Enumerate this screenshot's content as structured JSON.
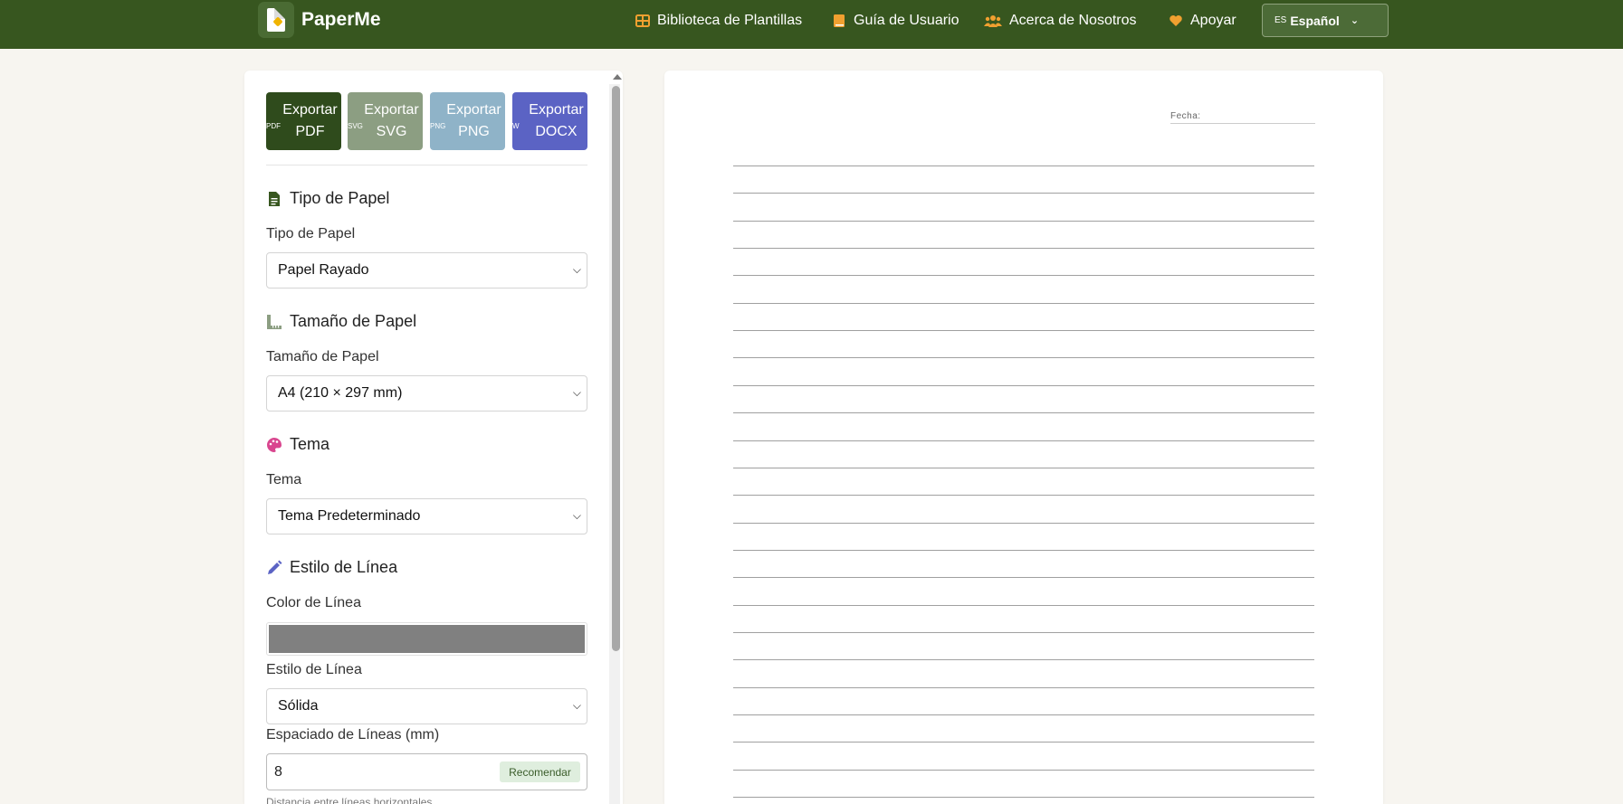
{
  "header": {
    "brand": "PaperMe",
    "nav": [
      {
        "label": "Biblioteca de Plantillas",
        "icon": "grid-icon"
      },
      {
        "label": "Guía de Usuario",
        "icon": "book-icon"
      },
      {
        "label": "Acerca de Nosotros",
        "icon": "users-icon"
      },
      {
        "label": "Apoyar",
        "icon": "heart-icon"
      }
    ],
    "language": {
      "code": "ES",
      "label": "Español"
    },
    "accent": "#37561f",
    "icon_color": "#f0a030"
  },
  "exports": [
    {
      "label": "Exportar PDF",
      "icon_text": "PDF",
      "color": "#2f4b1c"
    },
    {
      "label": "Exportar SVG",
      "icon_text": "SVG",
      "color": "#8c9e82"
    },
    {
      "label": "Exportar PNG",
      "icon_text": "PNG",
      "color": "#8fb3c8"
    },
    {
      "label": "Exportar DOCX",
      "icon_text": "W",
      "color": "#5b63c4"
    }
  ],
  "sections": {
    "paper_type": {
      "title": "Tipo de Papel",
      "label": "Tipo de Papel",
      "value": "Papel Rayado"
    },
    "paper_size": {
      "title": "Tamaño de Papel",
      "label": "Tamaño de Papel",
      "value": "A4 (210 × 297 mm)"
    },
    "theme": {
      "title": "Tema",
      "label": "Tema",
      "value": "Tema Predeterminado"
    },
    "line_style": {
      "title": "Estilo de Línea",
      "color_label": "Color de Línea",
      "color_value": "#808080",
      "style_label": "Estilo de Línea",
      "style_value": "Sólida",
      "spacing_label": "Espaciado de Líneas (mm)",
      "spacing_value": "8",
      "recommend_label": "Recomendar",
      "spacing_hint": "Distancia entre líneas horizontales"
    }
  },
  "preview": {
    "date_label": "Fecha:",
    "line_count": 24
  }
}
